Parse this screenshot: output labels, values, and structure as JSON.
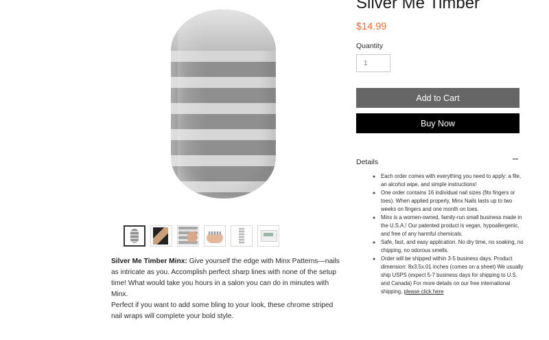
{
  "product": {
    "title": "Silver Me Timber",
    "price": "$14.99",
    "quantity_label": "Quantity",
    "quantity_value": "1"
  },
  "buttons": {
    "add_to_cart": "Add to Cart",
    "buy_now": "Buy Now"
  },
  "details": {
    "title": "Details",
    "items": [
      "Each order comes with everything you need to apply: a file, an alcohol wipe, and simple instructions!",
      "One order contains 16 individual nail sizes (fits fingers or toes). When applied properly, Minx Nails lasts up to two weeks on fingers and one month on toes.",
      "Minx is a women-owned, family-run small business made in the U.S.A.! Our patented product is vegan, hypoallergenic, and free of any harmful chemicals.",
      "Safe, fast, and easy application. No dry time, no soaking, no chipping, no odorous smells."
    ],
    "shipping_text": "Order will be shipped within 3-5 business days. Product dimension: 8x3.5x.01 inches (comes on a sheet) We usually ship USPS (expect 5-7 business days for shipping to U.S. and Canada) For more details on our free international shipping,",
    "shipping_link": "please click here"
  },
  "description": {
    "lead_bold": "Silver Me Timber Minx:",
    "lead_text": " Give yourself the edge with Minx Patterns—nails as intricate as you. Accomplish perfect sharp lines with none of the setup time! What would take you hours in a salon you can do in minutes with Minx.",
    "paragraph2": "Perfect if you want to add some bling to your look, these chrome striped nail wraps will complete your bold style."
  },
  "colors": {
    "price": "#e96a33",
    "add_to_cart_bg": "#666666",
    "buy_now_bg": "#000000"
  },
  "thumbnails": {
    "count": 6,
    "active_index": 0
  }
}
